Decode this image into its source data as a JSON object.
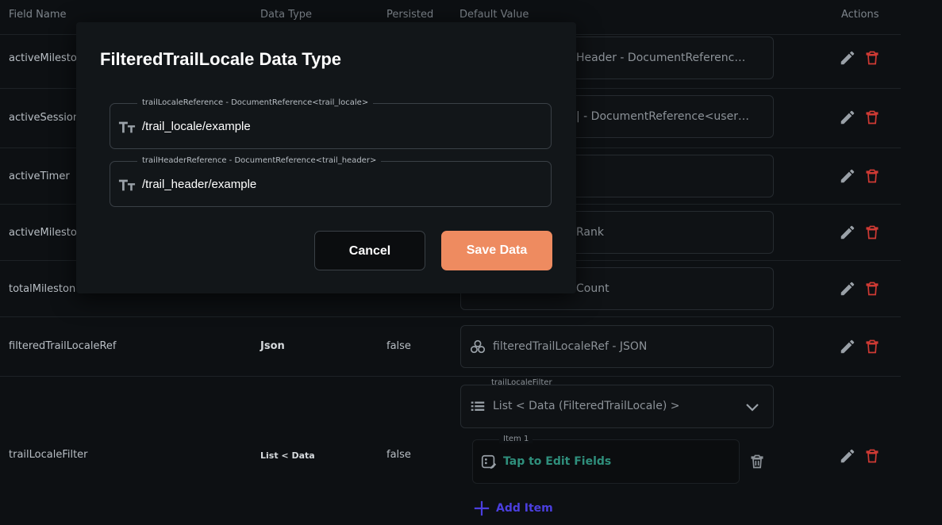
{
  "table": {
    "headers": {
      "field_name": "Field Name",
      "data_type": "Data Type",
      "persisted": "Persisted",
      "default_value": "Default Value",
      "actions": "Actions"
    },
    "rows": [
      {
        "name": "activeMilestor",
        "type": "",
        "persisted": "",
        "default": "Header - DocumentReferenc…"
      },
      {
        "name": "activeSessionI",
        "type": "",
        "persisted": "",
        "default": "| - DocumentReference<user…"
      },
      {
        "name": "activeTimer",
        "type": "",
        "persisted": "",
        "default": ""
      },
      {
        "name": "activeMilestor",
        "type": "",
        "persisted": "",
        "default": "Rank"
      },
      {
        "name": "totalMilestone",
        "type": "",
        "persisted": "",
        "default": "Count"
      },
      {
        "name": "filteredTrailLocaleRef",
        "type": "Json",
        "persisted": "false",
        "default": "filteredTrailLocaleRef - JSON"
      },
      {
        "name": "trailLocaleFilter",
        "type": "List < Data",
        "persisted": "false",
        "default": ""
      }
    ],
    "list_field": {
      "label": "trailLocaleFilter",
      "value": "List < Data (FilteredTrailLocale) >",
      "item_label": "Item 1",
      "item_action": "Tap to Edit Fields",
      "add_item": "Add Item"
    }
  },
  "modal": {
    "title": "FilteredTrailLocale Data Type",
    "fields": [
      {
        "label": "trailLocaleReference - DocumentReference<trail_locale>",
        "value": "/trail_locale/example"
      },
      {
        "label": "trailHeaderReference - DocumentReference<trail_header>",
        "value": "/trail_header/example"
      }
    ],
    "cancel_label": "Cancel",
    "save_label": "Save Data"
  },
  "colors": {
    "background": "#0d1013",
    "modal_bg": "#121619",
    "accent_save": "#ee8b60",
    "delete_red": "#d03a34",
    "add_item_blue": "#4b3fe0",
    "edit_fields_green": "#2f8f7c"
  },
  "icons": {
    "edit": "pencil-icon",
    "delete": "trash-icon",
    "text_type": "text-type-icon",
    "json": "json-icon",
    "list": "list-icon",
    "chevron": "chevron-down-icon",
    "add": "plus-icon",
    "edit_fields": "edit-fields-icon"
  }
}
